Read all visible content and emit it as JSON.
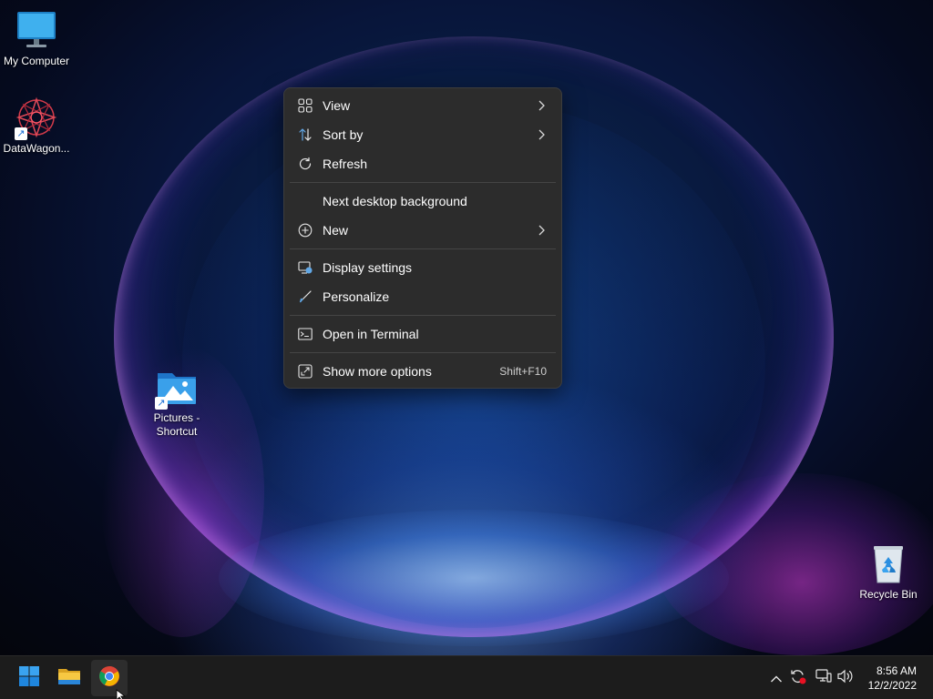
{
  "desktop": {
    "icons": [
      {
        "label": "My Computer",
        "icon": "monitor-icon"
      },
      {
        "label": "DataWagon...",
        "icon": "datawagon-app-icon"
      },
      {
        "label": "Pictures - Shortcut",
        "icon": "pictures-folder-icon"
      },
      {
        "label": "Recycle Bin",
        "icon": "recycle-bin-icon"
      }
    ]
  },
  "context_menu": {
    "items": [
      {
        "label": "View",
        "icon": "grid-icon",
        "submenu": true
      },
      {
        "label": "Sort by",
        "icon": "sort-arrows-icon",
        "submenu": true
      },
      {
        "label": "Refresh",
        "icon": "refresh-icon"
      },
      {
        "label": "Next desktop background",
        "icon": ""
      },
      {
        "label": "New",
        "icon": "plus-circle-icon",
        "submenu": true
      },
      {
        "label": "Display settings",
        "icon": "display-settings-icon"
      },
      {
        "label": "Personalize",
        "icon": "brush-icon"
      },
      {
        "label": "Open in Terminal",
        "icon": "terminal-icon"
      },
      {
        "label": "Show more options",
        "icon": "more-options-icon",
        "accelerator": "Shift+F10"
      }
    ]
  },
  "taskbar": {
    "apps": [
      {
        "name": "Start",
        "icon": "windows-start-icon"
      },
      {
        "name": "File Explorer",
        "icon": "folder-icon"
      },
      {
        "name": "Google Chrome",
        "icon": "chrome-icon",
        "active": true
      }
    ],
    "tray": [
      "chevron-up-icon",
      "sync-icon",
      "network-icon",
      "volume-icon"
    ],
    "clock": {
      "time": "8:56 AM",
      "date": "12/2/2022"
    }
  }
}
